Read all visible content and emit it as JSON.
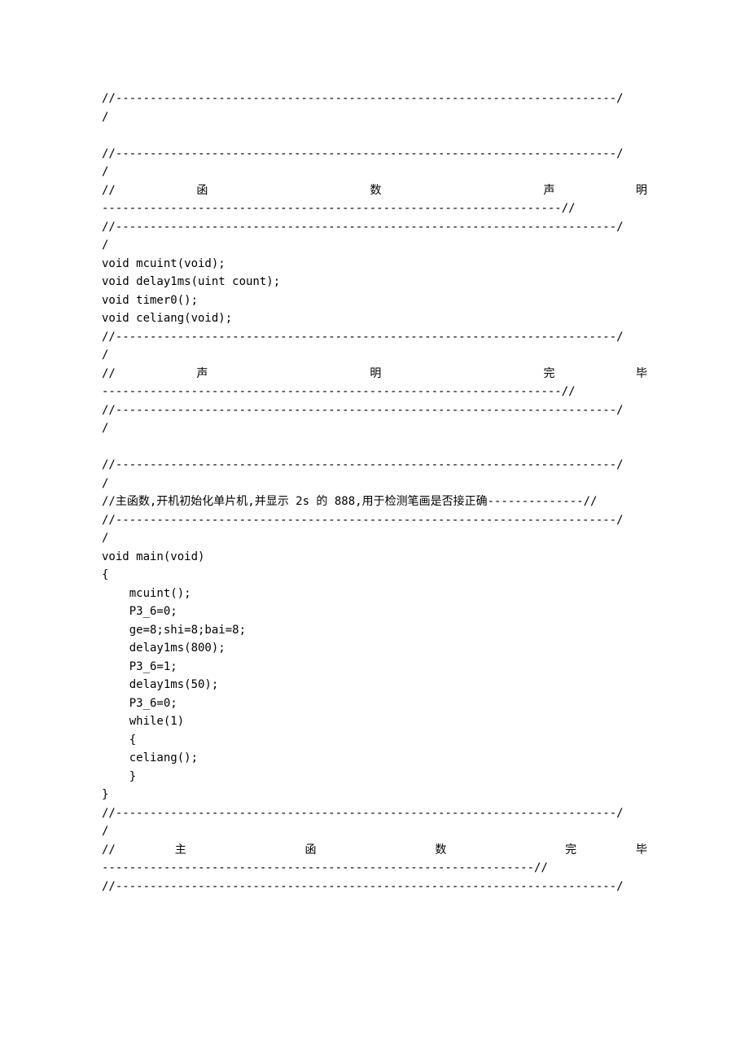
{
  "divider_row1": "//-------------------------------------------------------------------------/",
  "divider_row2": "/",
  "justified_lead": "//",
  "section_funcdecl_chars": [
    "函",
    "数",
    "声",
    "明"
  ],
  "section_funcdecl_dashes": "-------------------------------------------------------------------//",
  "decl_mcuint": "void mcuint(void);",
  "decl_delay1ms": "void delay1ms(uint count);",
  "decl_timer0": "void timer0();",
  "decl_celiang": "void celiang(void);",
  "section_declend_chars": [
    "声",
    "明",
    "完",
    "毕"
  ],
  "section_declend_dashes": "-------------------------------------------------------------------//",
  "main_comment": "//主函数,开机初始化单片机,并显示 2s 的 888,用于检测笔画是否接正确--------------//",
  "main_sig": "void main(void)",
  "brace_open": "{",
  "main_l1": "    mcuint();",
  "main_l2": "    P3_6=0;",
  "main_l3": "    ge=8;shi=8;bai=8;",
  "main_l4": "    delay1ms(800);",
  "main_l5": "    P3_6=1;",
  "main_l6": "    delay1ms(50);",
  "main_l7": "    P3_6=0;",
  "main_l8": "    while(1)",
  "main_l9": "    {",
  "main_l10": "    celiang();",
  "main_l11": "    }",
  "brace_close": "}",
  "section_mainend_chars": [
    "主",
    "函",
    "数",
    "完",
    "毕"
  ],
  "section_mainend_dashes": "---------------------------------------------------------------//"
}
